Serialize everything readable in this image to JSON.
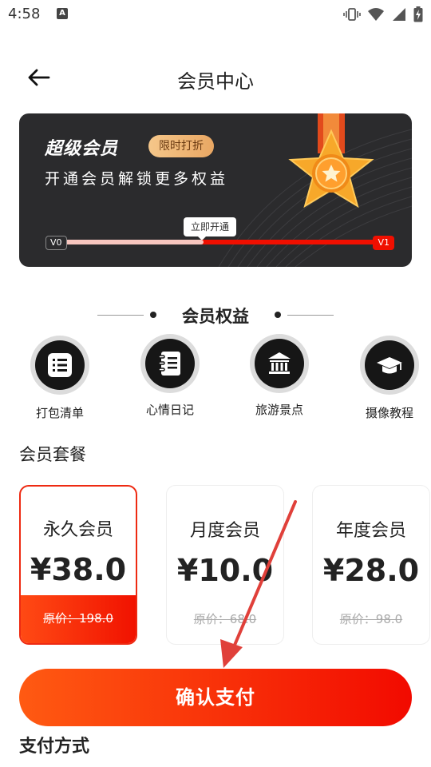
{
  "status_bar": {
    "time": "4:58",
    "notification_badge": "A",
    "icons": [
      "vibrate-icon",
      "wifi-icon",
      "cellular-signal-icon",
      "battery-charging-icon"
    ]
  },
  "header": {
    "title": "会员中心",
    "back_icon": "arrow-left-icon"
  },
  "banner": {
    "title": "超级会员",
    "badge": "限时打折",
    "subtitle": "开通会员解锁更多权益",
    "progress": {
      "start_label": "V0",
      "end_label": "V1",
      "tip": "立即开通",
      "filled_fraction": 0.44
    },
    "medal_icon": "star-medal-icon",
    "colors": {
      "background": "#2b2b2d",
      "accent_red": "#f00f00",
      "badge_gold": "#f5c78a"
    }
  },
  "benefits": {
    "title": "会员权益",
    "items": [
      {
        "label": "打包清单",
        "icon": "checklist-icon"
      },
      {
        "label": "心情日记",
        "icon": "notebook-icon"
      },
      {
        "label": "旅游景点",
        "icon": "landmark-icon"
      },
      {
        "label": "摄像教程",
        "icon": "graduation-cap-icon"
      }
    ]
  },
  "plans": {
    "title": "会员套餐",
    "items": [
      {
        "name": "永久会员",
        "price": "¥38.0",
        "original": "原价：198.0",
        "selected": true
      },
      {
        "name": "月度会员",
        "price": "¥10.0",
        "original": "原价：68.0",
        "selected": false
      },
      {
        "name": "年度会员",
        "price": "¥28.0",
        "original": "原价：98.0",
        "selected": false
      }
    ]
  },
  "actions": {
    "confirm_pay": "确认支付"
  },
  "payment": {
    "title": "支付方式"
  },
  "colors": {
    "primary_red": "#f20a00",
    "primary_orange": "#ff5a12",
    "annotation_arrow": "#e0403a"
  }
}
